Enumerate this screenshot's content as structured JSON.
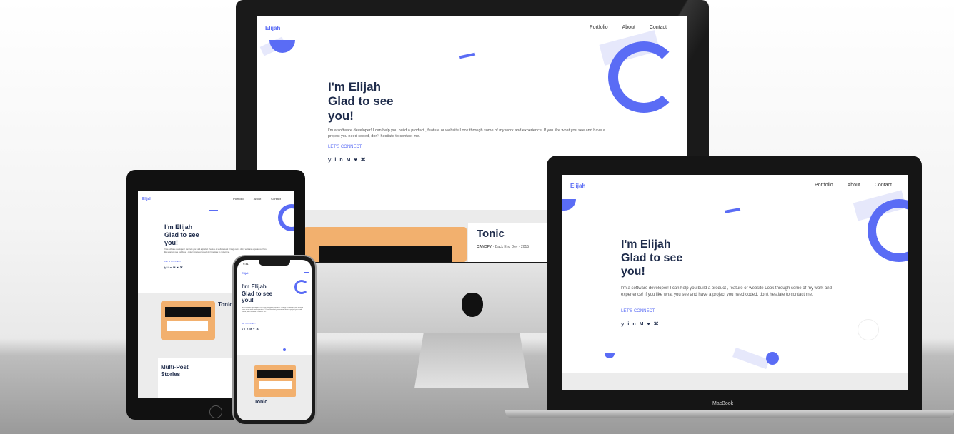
{
  "site": {
    "logo": "Elijah",
    "nav": [
      "Portfolio",
      "About",
      "Contact"
    ],
    "heading_lines": [
      "I'm Elijah",
      "Glad to see",
      "you!"
    ],
    "intro": "I'm a software developer! I can help you build a product , feature or website Look through some of my work and experience! If you like what you see and have a project you need coded, don't hestiate to contact me.",
    "cta": "LET'S CONNECT",
    "social_icons": [
      "twitter-icon",
      "linkedin-icon",
      "medium-icon",
      "github-icon",
      "codepen-icon"
    ],
    "social_glyphs": [
      "𝕪",
      "in",
      "M",
      "♥",
      "⌘"
    ]
  },
  "projects": [
    {
      "title": "Tonic",
      "tags": [
        "CANOPY",
        "Back End Dev",
        "2015"
      ]
    },
    {
      "title": "Multi-Post Stories"
    }
  ],
  "phone": {
    "time": "9:41"
  },
  "laptop": {
    "brand": "MacBook"
  },
  "colors": {
    "accent": "#5a6cf5",
    "heading": "#1f2c4b",
    "card": "#f2b06e"
  }
}
